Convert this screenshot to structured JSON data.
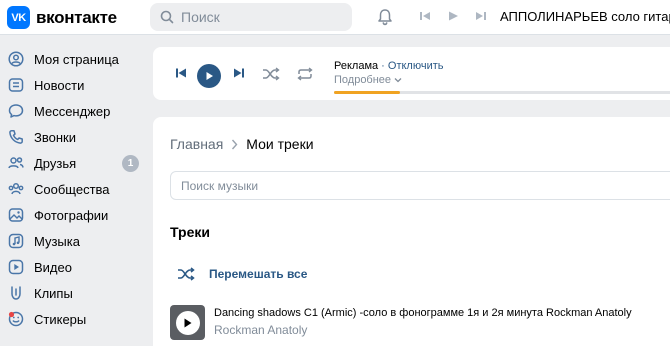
{
  "header": {
    "logo_badge": "VK",
    "logo_text": "вконтакте",
    "search_placeholder": "Поиск",
    "now_playing": "АППОЛИНАРЬЕВ соло гитара"
  },
  "sidebar": {
    "items": [
      {
        "label": "Моя страница",
        "icon": "user-circle-icon"
      },
      {
        "label": "Новости",
        "icon": "news-icon"
      },
      {
        "label": "Мессенджер",
        "icon": "message-icon"
      },
      {
        "label": "Звонки",
        "icon": "phone-icon"
      },
      {
        "label": "Друзья",
        "icon": "friends-icon",
        "badge": "1"
      },
      {
        "label": "Сообщества",
        "icon": "communities-icon"
      },
      {
        "label": "Фотографии",
        "icon": "photo-icon"
      },
      {
        "label": "Музыка",
        "icon": "music-icon"
      },
      {
        "label": "Видео",
        "icon": "video-icon"
      },
      {
        "label": "Клипы",
        "icon": "clips-icon"
      },
      {
        "label": "Стикеры",
        "icon": "stickers-icon"
      }
    ]
  },
  "player": {
    "ad_title": "Реклама",
    "ad_separator": " · ",
    "ad_disable": "Отключить",
    "ad_more": "Подробнее",
    "progress": 0.19
  },
  "main": {
    "breadcrumb_home": "Главная",
    "breadcrumb_current": "Мои треки",
    "search_placeholder": "Поиск музыки",
    "tracks_title": "Треки",
    "shuffle_label": "Перемешать все",
    "tracks": [
      {
        "title": "Dancing shadows C1 (Armic) -соло в фонограмме 1я и 2я минута Rockman Anatoly",
        "artist": "Rockman Anatoly"
      }
    ]
  },
  "colors": {
    "accent": "#2a5885",
    "brand": "#0077ff",
    "progress": "#f0a322",
    "icon": "#4a76a8",
    "badge": "#b0b8c3"
  }
}
